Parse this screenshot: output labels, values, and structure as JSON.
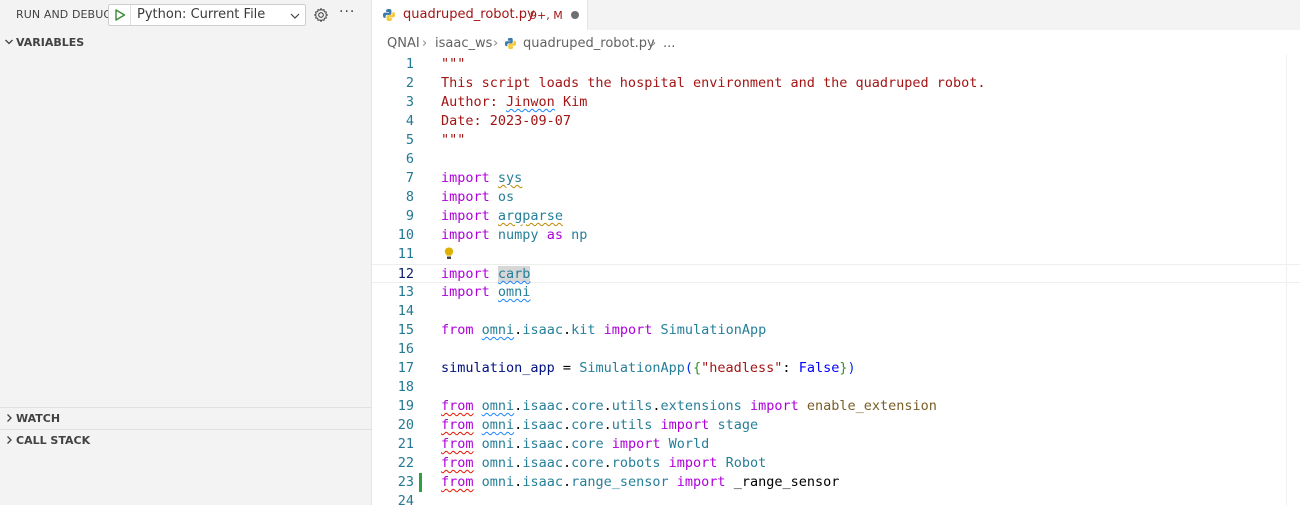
{
  "sidebar": {
    "title": "RUN AND DEBUG",
    "config": {
      "selected": "Python: Current File"
    },
    "more": "···",
    "sections": {
      "variables": "VARIABLES",
      "watch": "WATCH",
      "call_stack": "CALL STACK"
    }
  },
  "editor": {
    "tab": {
      "title": "quadruped_robot.py",
      "badge": "9+, M"
    },
    "breadcrumb": {
      "root": "QNAI",
      "folder": "isaac_ws",
      "file": "quadruped_robot.py",
      "more": "..."
    },
    "current_line": 12,
    "modified_line": 23,
    "lines": [
      {
        "n": "1",
        "tokens": [
          [
            "s",
            "\"\"\""
          ]
        ]
      },
      {
        "n": "2",
        "tokens": [
          [
            "s",
            "This script loads the hospital environment and the quadruped robot."
          ]
        ]
      },
      {
        "n": "3",
        "tokens": [
          [
            "s",
            "Author: "
          ],
          [
            "s sq-b",
            "Jinwon"
          ],
          [
            "s",
            " Kim"
          ]
        ]
      },
      {
        "n": "4",
        "tokens": [
          [
            "s",
            "Date: 2023-09-07"
          ]
        ]
      },
      {
        "n": "5",
        "tokens": [
          [
            "s",
            "\"\"\""
          ]
        ]
      },
      {
        "n": "6",
        "tokens": []
      },
      {
        "n": "7",
        "tokens": [
          [
            "k",
            "import"
          ],
          [
            "plain",
            " "
          ],
          [
            "m sq-y",
            "sys"
          ]
        ]
      },
      {
        "n": "8",
        "tokens": [
          [
            "k",
            "import"
          ],
          [
            "plain",
            " "
          ],
          [
            "m",
            "os"
          ]
        ]
      },
      {
        "n": "9",
        "tokens": [
          [
            "k",
            "import"
          ],
          [
            "plain",
            " "
          ],
          [
            "m sq-y",
            "argparse"
          ]
        ]
      },
      {
        "n": "10",
        "tokens": [
          [
            "k",
            "import"
          ],
          [
            "plain",
            " "
          ],
          [
            "m",
            "numpy"
          ],
          [
            "plain",
            " "
          ],
          [
            "k",
            "as"
          ],
          [
            "plain",
            " "
          ],
          [
            "m",
            "np"
          ]
        ]
      },
      {
        "n": "11",
        "tokens": [],
        "bulb": true
      },
      {
        "n": "12",
        "tokens": [
          [
            "k",
            "import"
          ],
          [
            "plain",
            " "
          ],
          [
            "m sq-b hl",
            "carb"
          ]
        ]
      },
      {
        "n": "13",
        "tokens": [
          [
            "k",
            "import"
          ],
          [
            "plain",
            " "
          ],
          [
            "m sq-b",
            "omni"
          ]
        ]
      },
      {
        "n": "14",
        "tokens": []
      },
      {
        "n": "15",
        "tokens": [
          [
            "k",
            "from"
          ],
          [
            "plain",
            " "
          ],
          [
            "m sq-b",
            "omni"
          ],
          [
            "plain",
            "."
          ],
          [
            "m",
            "isaac"
          ],
          [
            "plain",
            "."
          ],
          [
            "m",
            "kit"
          ],
          [
            "plain",
            " "
          ],
          [
            "k",
            "import"
          ],
          [
            "plain",
            " "
          ],
          [
            "m",
            "SimulationApp"
          ]
        ]
      },
      {
        "n": "16",
        "tokens": []
      },
      {
        "n": "17",
        "tokens": [
          [
            "v",
            "simulation_app"
          ],
          [
            "plain",
            " = "
          ],
          [
            "m",
            "SimulationApp"
          ],
          [
            "p1",
            "("
          ],
          [
            "p2",
            "{"
          ],
          [
            "s",
            "\"headless\""
          ],
          [
            "plain",
            ": "
          ],
          [
            "b",
            "False"
          ],
          [
            "p2",
            "}"
          ],
          [
            "p1",
            ")"
          ]
        ]
      },
      {
        "n": "18",
        "tokens": []
      },
      {
        "n": "19",
        "tokens": [
          [
            "k sq-r",
            "from"
          ],
          [
            "plain",
            " "
          ],
          [
            "m sq-b",
            "omni"
          ],
          [
            "plain",
            "."
          ],
          [
            "m",
            "isaac"
          ],
          [
            "plain",
            "."
          ],
          [
            "m",
            "core"
          ],
          [
            "plain",
            "."
          ],
          [
            "m",
            "utils"
          ],
          [
            "plain",
            "."
          ],
          [
            "m",
            "extensions"
          ],
          [
            "plain",
            " "
          ],
          [
            "k",
            "import"
          ],
          [
            "plain",
            " "
          ],
          [
            "f",
            "enable_extension"
          ]
        ]
      },
      {
        "n": "20",
        "tokens": [
          [
            "k sq-r",
            "from"
          ],
          [
            "plain",
            " "
          ],
          [
            "m sq-b",
            "omni"
          ],
          [
            "plain",
            "."
          ],
          [
            "m",
            "isaac"
          ],
          [
            "plain",
            "."
          ],
          [
            "m",
            "core"
          ],
          [
            "plain",
            "."
          ],
          [
            "m",
            "utils"
          ],
          [
            "plain",
            " "
          ],
          [
            "k",
            "import"
          ],
          [
            "plain",
            " "
          ],
          [
            "m",
            "stage"
          ]
        ]
      },
      {
        "n": "21",
        "tokens": [
          [
            "k sq-r",
            "from"
          ],
          [
            "plain",
            " "
          ],
          [
            "m",
            "omni"
          ],
          [
            "plain",
            "."
          ],
          [
            "m",
            "isaac"
          ],
          [
            "plain",
            "."
          ],
          [
            "m",
            "core"
          ],
          [
            "plain",
            " "
          ],
          [
            "k",
            "import"
          ],
          [
            "plain",
            " "
          ],
          [
            "m",
            "World"
          ]
        ]
      },
      {
        "n": "22",
        "tokens": [
          [
            "k sq-r",
            "from"
          ],
          [
            "plain",
            " "
          ],
          [
            "m",
            "omni"
          ],
          [
            "plain",
            "."
          ],
          [
            "m",
            "isaac"
          ],
          [
            "plain",
            "."
          ],
          [
            "m",
            "core"
          ],
          [
            "plain",
            "."
          ],
          [
            "m",
            "robots"
          ],
          [
            "plain",
            " "
          ],
          [
            "k",
            "import"
          ],
          [
            "plain",
            " "
          ],
          [
            "m",
            "Robot"
          ]
        ]
      },
      {
        "n": "23",
        "tokens": [
          [
            "k sq-r",
            "from"
          ],
          [
            "plain",
            " "
          ],
          [
            "m",
            "omni"
          ],
          [
            "plain",
            "."
          ],
          [
            "m",
            "isaac"
          ],
          [
            "plain",
            "."
          ],
          [
            "m",
            "range_sensor"
          ],
          [
            "plain",
            " "
          ],
          [
            "k",
            "import"
          ],
          [
            "plain",
            " "
          ],
          [
            "plain",
            "_range_sensor"
          ]
        ]
      },
      {
        "n": "24",
        "tokens": []
      }
    ]
  },
  "colors": {
    "keyword": "#af00db",
    "string": "#a31515",
    "module": "#267f99",
    "line_number": "#237893",
    "git_added": "#2ea043"
  },
  "icons": [
    "play-icon",
    "chevron-down-icon",
    "gear-icon",
    "python-file-icon",
    "lightbulb-icon",
    "chevron-right-icon"
  ]
}
